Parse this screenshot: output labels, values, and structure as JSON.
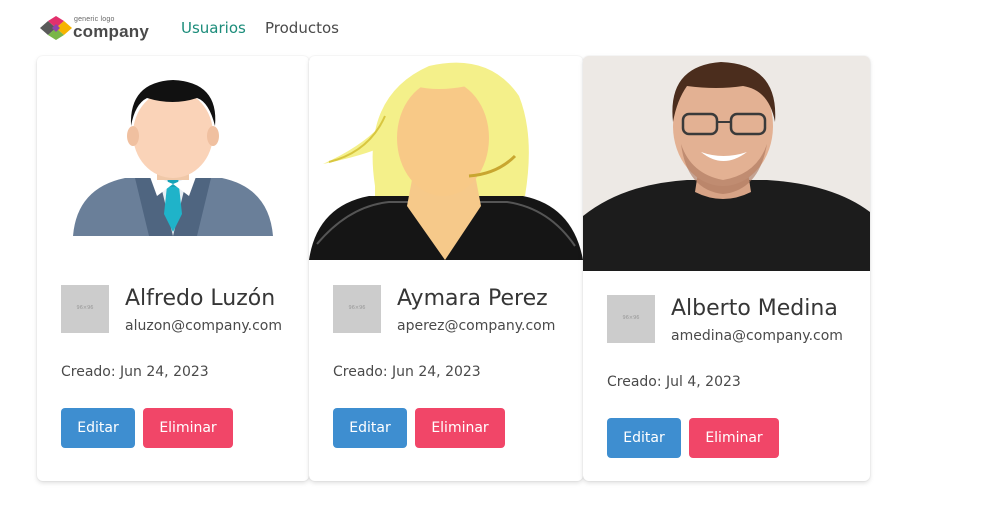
{
  "brand": {
    "small_text": "generic logo",
    "big_text": "company"
  },
  "nav": {
    "users": "Usuarios",
    "products": "Productos"
  },
  "users": [
    {
      "name": "Alfredo Luzón",
      "email": "aluzon@company.com",
      "created": "Creado: Jun 24, 2023",
      "edit": "Editar",
      "delete": "Eliminar"
    },
    {
      "name": "Aymara Perez",
      "email": "aperez@company.com",
      "created": "Creado: Jun 24, 2023",
      "edit": "Editar",
      "delete": "Eliminar"
    },
    {
      "name": "Alberto Medina",
      "email": "amedina@company.com",
      "created": "Creado: Jul 4, 2023",
      "edit": "Editar",
      "delete": "Eliminar"
    }
  ],
  "colors": {
    "active_nav": "#1b8c7a",
    "edit_button": "#3e8ed0",
    "delete_button": "#f14668"
  }
}
